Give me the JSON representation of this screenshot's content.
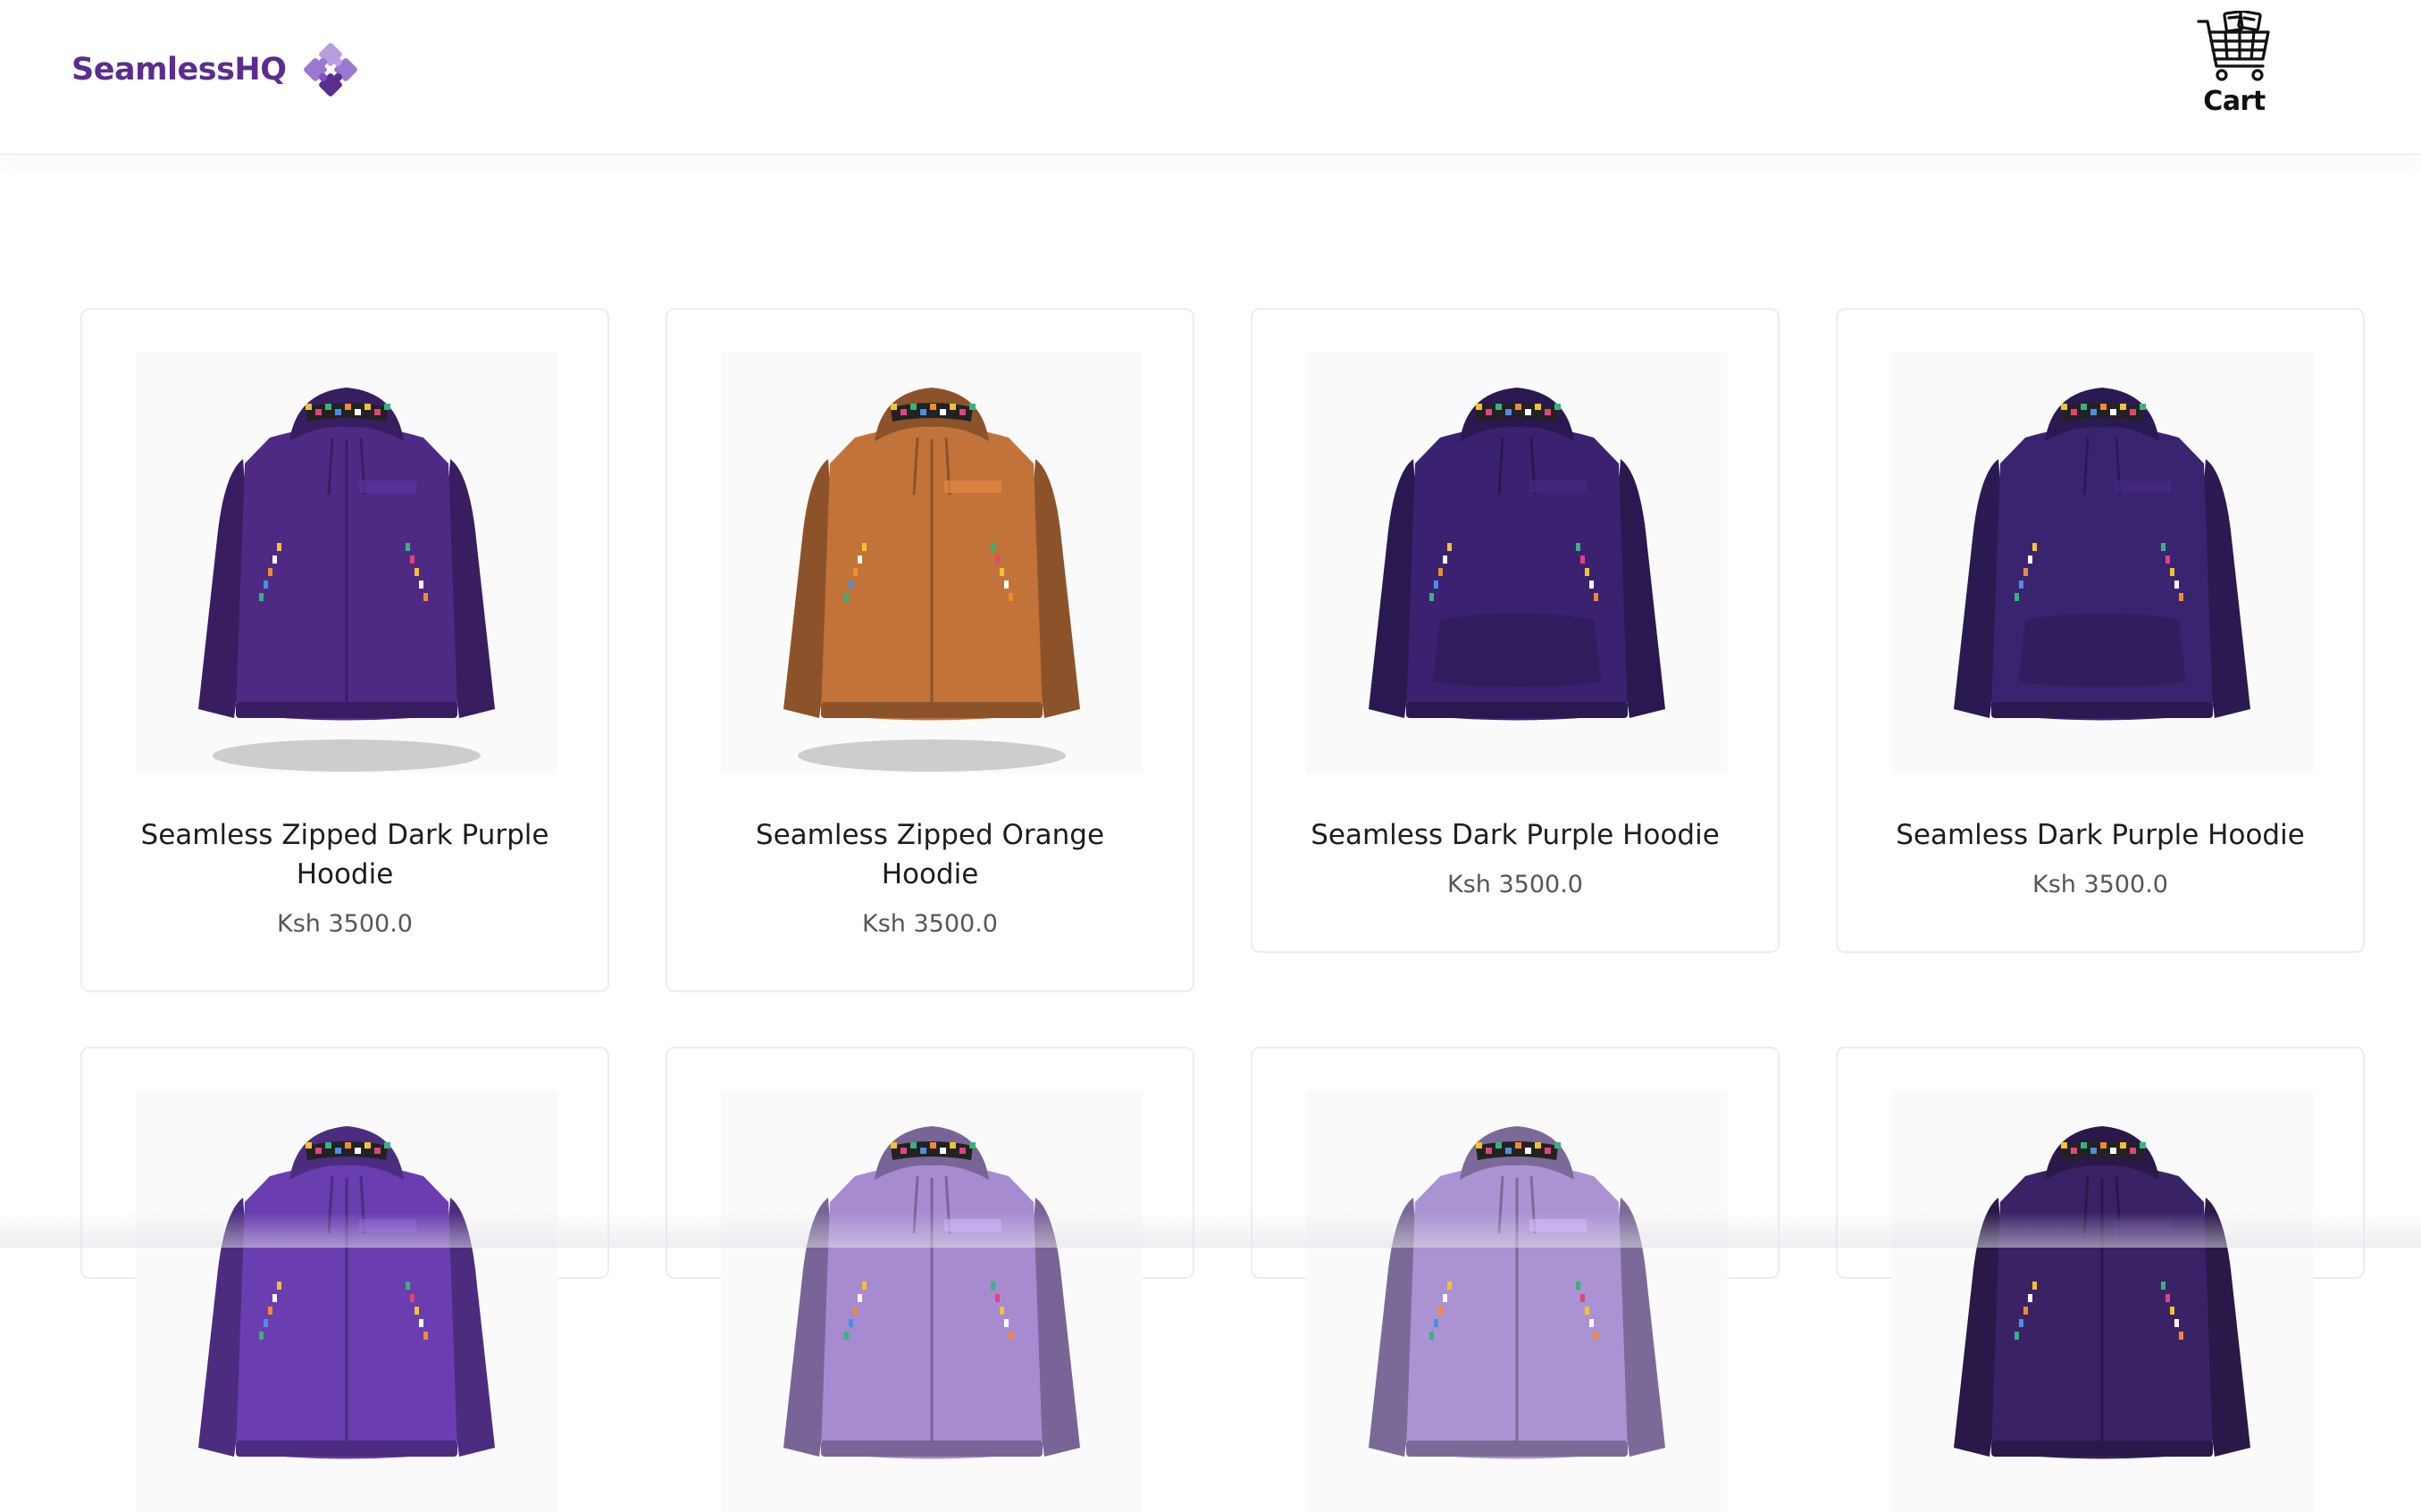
{
  "header": {
    "brand": "SeamlessHQ",
    "cart_label": "Cart",
    "logo_colors": [
      "#b79fdc",
      "#9a78cf",
      "#7b52bd",
      "#5b2d8e"
    ]
  },
  "products": [
    {
      "name": "Seamless Zipped Dark Purple Hoodie",
      "price": "Ksh 3500.0",
      "color": "#4e2a85",
      "style": "zip",
      "shadow": true
    },
    {
      "name": "Seamless Zipped Orange Hoodie",
      "price": "Ksh 3500.0",
      "color": "#c2733a",
      "style": "zip",
      "shadow": true
    },
    {
      "name": "Seamless Dark Purple Hoodie",
      "price": "Ksh 3500.0",
      "color": "#3b2270",
      "style": "pullover",
      "shadow": false
    },
    {
      "name": "Seamless Dark Purple Hoodie",
      "price": "Ksh 3500.0",
      "color": "#3a2470",
      "style": "pullover",
      "shadow": false
    },
    {
      "name": "",
      "price": "",
      "color": "#6a3db0",
      "style": "zip",
      "shadow": false
    },
    {
      "name": "",
      "price": "",
      "color": "#a78bd1",
      "style": "zip",
      "shadow": false
    },
    {
      "name": "",
      "price": "",
      "color": "#ab93d3",
      "style": "zip",
      "shadow": false
    },
    {
      "name": "",
      "price": "",
      "color": "#3a2266",
      "style": "zip",
      "shadow": false
    }
  ]
}
